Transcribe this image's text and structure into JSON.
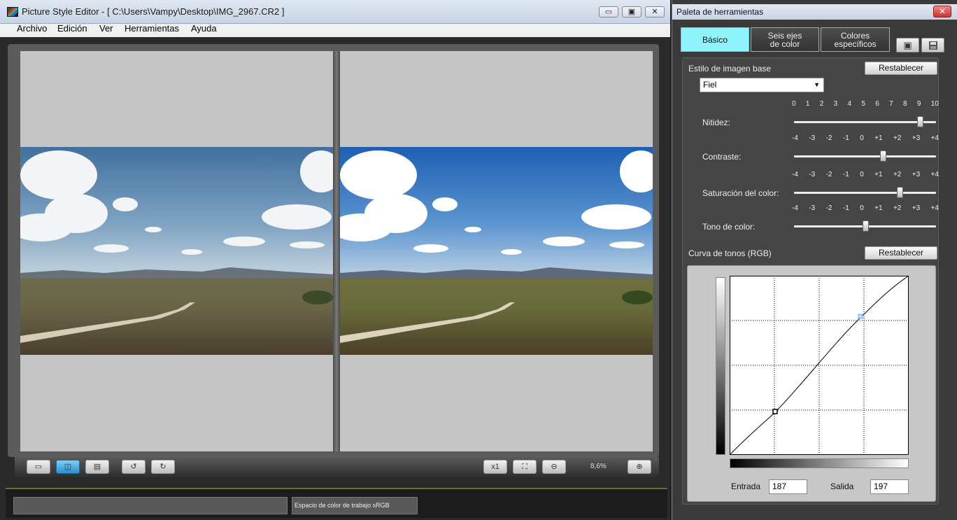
{
  "main_window": {
    "title": "Picture Style Editor - [ C:\\Users\\Vampy\\Desktop\\IMG_2967.CR2 ]",
    "controls": {
      "minimize": "▭",
      "maximize": "▣",
      "close": "✕"
    },
    "menu": [
      "Archivo",
      "Edición",
      "Ver",
      "Herramientas",
      "Ayuda"
    ],
    "toolbar": {
      "view_single": "▭",
      "view_side_by_side": "◫",
      "view_top_bottom": "▤",
      "rotate_left": "↺",
      "rotate_right": "↻",
      "zoom_1x": "x1",
      "fit": "⛶",
      "zoom_out": "⊖",
      "zoom_level": "8,6%",
      "zoom_in": "⊕"
    },
    "status": {
      "left_text": "",
      "workspace": "Espacio de color de trabajo sRGB"
    }
  },
  "palette": {
    "title": "Paleta de herramientas",
    "close": "✕",
    "tabs": [
      {
        "line1": "Básico",
        "line2": ""
      },
      {
        "line1": "Seis ejes",
        "line2": "de color"
      },
      {
        "line1": "Colores",
        "line2": "específicos"
      }
    ],
    "icon_open": "▣",
    "icon_save": "💾",
    "base": {
      "label": "Estilo de imagen base",
      "reset": "Restablecer",
      "selected": "Fiel",
      "arrow": "▼"
    },
    "sliders": [
      {
        "label": "Nitidez:",
        "ticks": [
          "0",
          "1",
          "2",
          "3",
          "4",
          "5",
          "6",
          "7",
          "8",
          "9",
          "10"
        ],
        "value": 9,
        "min": 0,
        "max": 10
      },
      {
        "label": "Contraste:",
        "ticks": [
          "-4",
          "-3",
          "-2",
          "-1",
          "0",
          "+1",
          "+2",
          "+3",
          "+4"
        ],
        "value": 1,
        "min": -4,
        "max": 4
      },
      {
        "label": "Saturación del color:",
        "ticks": [
          "-4",
          "-3",
          "-2",
          "-1",
          "0",
          "+1",
          "+2",
          "+3",
          "+4"
        ],
        "value": 2,
        "min": -4,
        "max": 4
      },
      {
        "label": "Tono de color:",
        "ticks": [
          "-4",
          "-3",
          "-2",
          "-1",
          "0",
          "+1",
          "+2",
          "+3",
          "+4"
        ],
        "value": 0,
        "min": -4,
        "max": 4
      }
    ],
    "curve": {
      "label": "Curva de tonos (RGB)",
      "reset": "Restablecer",
      "input_label": "Entrada",
      "input_value": "187",
      "output_label": "Salida",
      "output_value": "197"
    }
  }
}
